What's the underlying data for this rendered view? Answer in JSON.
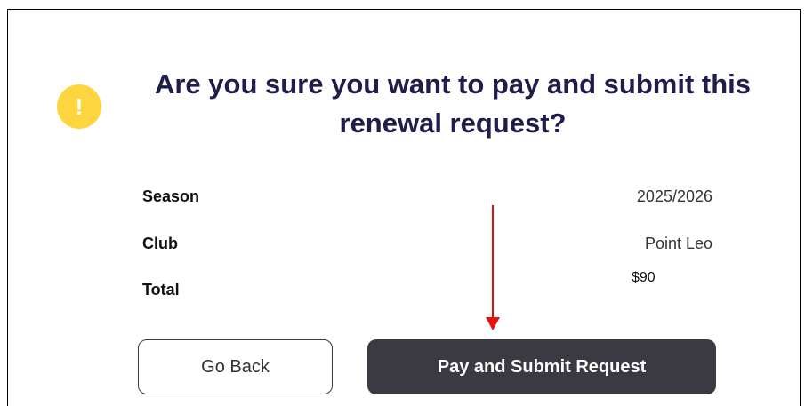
{
  "dialog": {
    "title": "Are you sure you want to pay and submit this renewal request?",
    "warning_glyph": "!",
    "icon": "exclamation-circle-icon",
    "colors": {
      "title": "#1f1d4a",
      "warning": "#fcd53f",
      "primary_button": "#3b3a42",
      "annotation_arrow": "#e8110b"
    }
  },
  "details": {
    "season": {
      "label": "Season",
      "value": "2025/2026"
    },
    "club": {
      "label": "Club",
      "value": "Point Leo"
    },
    "total": {
      "label": "Total",
      "value": "$90"
    }
  },
  "buttons": {
    "back_label": "Go Back",
    "pay_label": "Pay and Submit Request"
  }
}
